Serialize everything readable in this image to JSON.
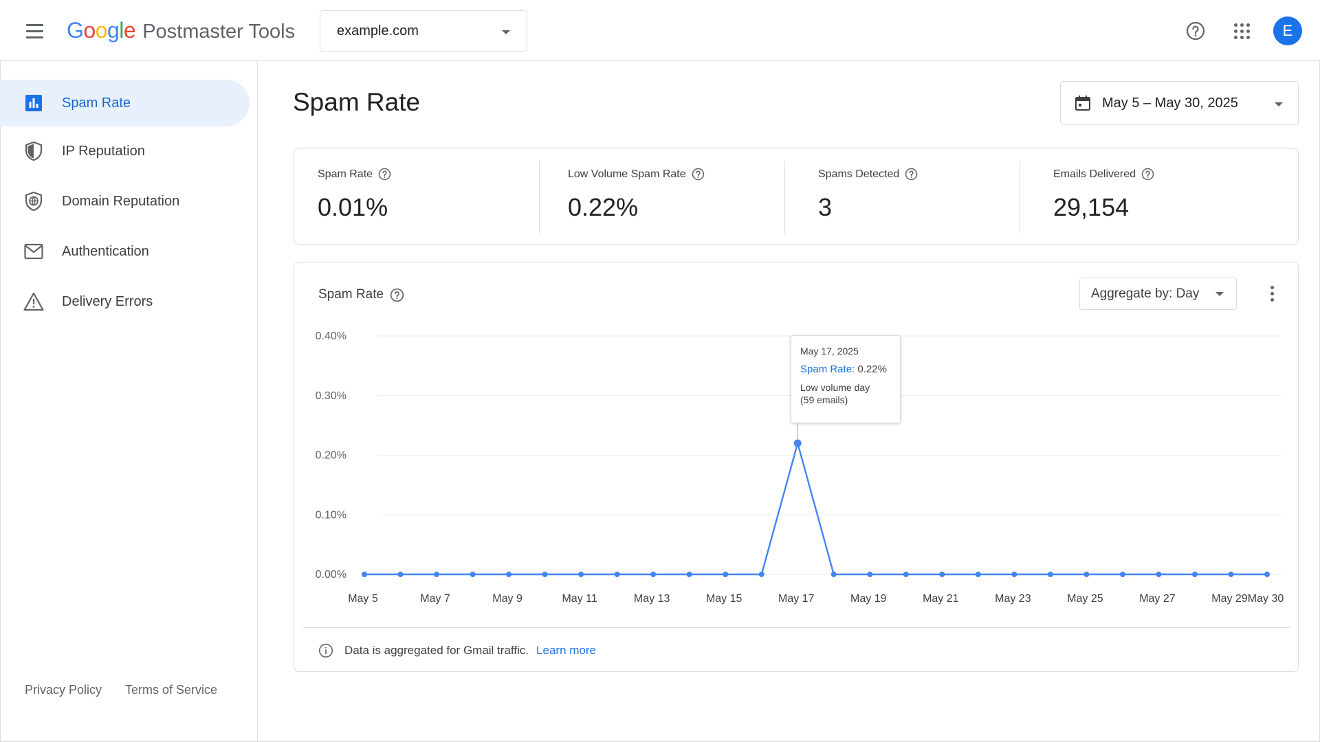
{
  "header": {
    "logo": {
      "G": "G",
      "o1": "o",
      "o2": "o",
      "g": "g",
      "l": "l",
      "e": "e"
    },
    "product": "Postmaster Tools",
    "domain": "example.com",
    "avatar_letter": "E"
  },
  "sidebar": {
    "items": [
      {
        "label": "Spam Rate",
        "icon": "bar-chart-icon",
        "active": true
      },
      {
        "label": "IP Reputation",
        "icon": "shield-icon",
        "active": false
      },
      {
        "label": "Domain Reputation",
        "icon": "shield-globe-icon",
        "active": false
      },
      {
        "label": "Authentication",
        "icon": "mail-icon",
        "active": false
      },
      {
        "label": "Delivery Errors",
        "icon": "warning-icon",
        "active": false
      }
    ],
    "footer": {
      "privacy": "Privacy Policy",
      "terms": "Terms of Service"
    }
  },
  "main": {
    "title": "Spam Rate",
    "date_range": "May 5 – May 30, 2025",
    "metrics": [
      {
        "label": "Spam Rate",
        "value": "0.01%"
      },
      {
        "label": "Low Volume Spam Rate",
        "value": "0.22%"
      },
      {
        "label": "Spams Detected",
        "value": "3"
      },
      {
        "label": "Emails Delivered",
        "value": "29,154"
      }
    ],
    "chart_card": {
      "title": "Spam Rate",
      "aggregate": "Aggregate by: Day",
      "note": "Data is aggregated for Gmail traffic.",
      "learn_more": "Learn more",
      "tooltip": {
        "date": "May 17, 2025",
        "rate_label": "Spam Rate:",
        "rate_value": "0.22%",
        "note_line1": "Low volume day",
        "note_line2": "(59 emails)"
      }
    }
  },
  "colors": {
    "accent": "#1a73e8",
    "series": "#4285f4",
    "active_nav_bg": "#e8f0fe"
  },
  "chart_data": {
    "type": "line",
    "title": "Spam Rate",
    "xlabel": "",
    "ylabel": "",
    "ylim": [
      0,
      0.4
    ],
    "y_ticks": [
      "0.00%",
      "0.10%",
      "0.20%",
      "0.30%",
      "0.40%"
    ],
    "y_tick_values": [
      0,
      0.1,
      0.2,
      0.3,
      0.4
    ],
    "x_ticks": [
      "May 5",
      "May 7",
      "May 9",
      "May 11",
      "May 13",
      "May 15",
      "May 17",
      "May 19",
      "May 21",
      "May 23",
      "May 25",
      "May 27",
      "May 29",
      "May 30"
    ],
    "x_tick_days": [
      5,
      7,
      9,
      11,
      13,
      15,
      17,
      19,
      21,
      23,
      25,
      27,
      29,
      30
    ],
    "grid": true,
    "series": [
      {
        "values_percent": [
          0,
          0,
          0,
          0,
          0,
          0,
          0,
          0,
          0,
          0,
          0,
          0,
          0.22,
          0,
          0,
          0,
          0,
          0,
          0,
          0,
          0,
          0,
          0,
          0,
          0,
          0
        ],
        "x_days": [
          5,
          6,
          7,
          8,
          9,
          10,
          11,
          12,
          13,
          14,
          15,
          16,
          17,
          18,
          19,
          20,
          21,
          22,
          23,
          24,
          25,
          26,
          27,
          28,
          29,
          30
        ]
      }
    ],
    "highlight_day": 17
  }
}
